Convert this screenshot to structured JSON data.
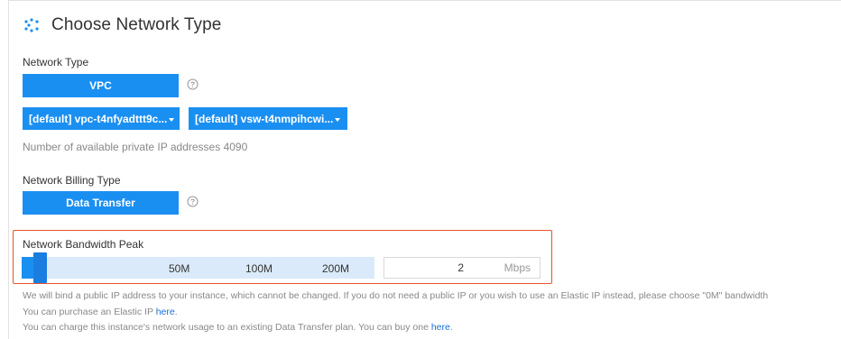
{
  "section": {
    "title": "Choose Network Type",
    "icon": "network-dots-icon"
  },
  "network_type": {
    "label": "Network Type",
    "selected_button": "VPC",
    "help_icon": "help-circle-icon"
  },
  "vpc_select": {
    "value": "[default] vpc-t4nfyadttt9c..."
  },
  "vswitch_select": {
    "value": "[default] vsw-t4nmpihcwi..."
  },
  "available_ips": {
    "text": "Number of available private IP addresses 4090"
  },
  "billing_type": {
    "label": "Network Billing Type",
    "selected_button": "Data Transfer",
    "help_icon": "help-circle-icon"
  },
  "bandwidth": {
    "label": "Network Bandwidth Peak",
    "ticks": [
      "50M",
      "100M",
      "200M"
    ],
    "value": "2",
    "unit": "Mbps",
    "slider_fraction": 0.01
  },
  "notes": {
    "line1": "We will bind a public IP address to your instance, which cannot be changed. If you do not need a public IP or you wish to use an Elastic IP instead, please choose \"0M\" bandwidth",
    "line2_prefix": "You can purchase an Elastic IP ",
    "line2_link": "here",
    "line2_suffix": ".",
    "line3_prefix": "You can charge this instance's network usage to an existing Data Transfer plan. You can buy one ",
    "line3_link": "here",
    "line3_suffix": "."
  },
  "colors": {
    "accent": "#1a8ff2",
    "highlight_border": "#e8542b",
    "link": "#1a6fd8"
  }
}
